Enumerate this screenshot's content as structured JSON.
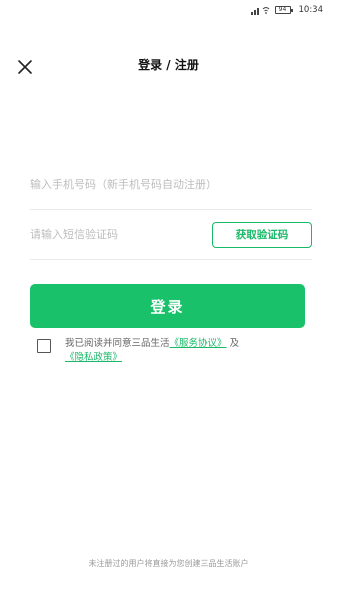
{
  "status_bar": {
    "indicators": "᯾ ⫶",
    "battery": "94",
    "time": "10:34"
  },
  "header": {
    "title": "登录 / 注册"
  },
  "form": {
    "phone_placeholder": "输入手机号码（新手机号码自动注册）",
    "code_placeholder": "请输入短信验证码",
    "get_code_label": "获取验证码",
    "login_label": "登录"
  },
  "agreement": {
    "prefix": "我已阅读并同意三品生活",
    "service_link": "《服务协议》",
    "conjunction": "及",
    "privacy_link": "《隐私政策》"
  },
  "footer": {
    "note": "未注册过的用户将直接为您创建三品生活账户"
  },
  "colors": {
    "accent": "#19c16a",
    "link": "#19b968"
  }
}
